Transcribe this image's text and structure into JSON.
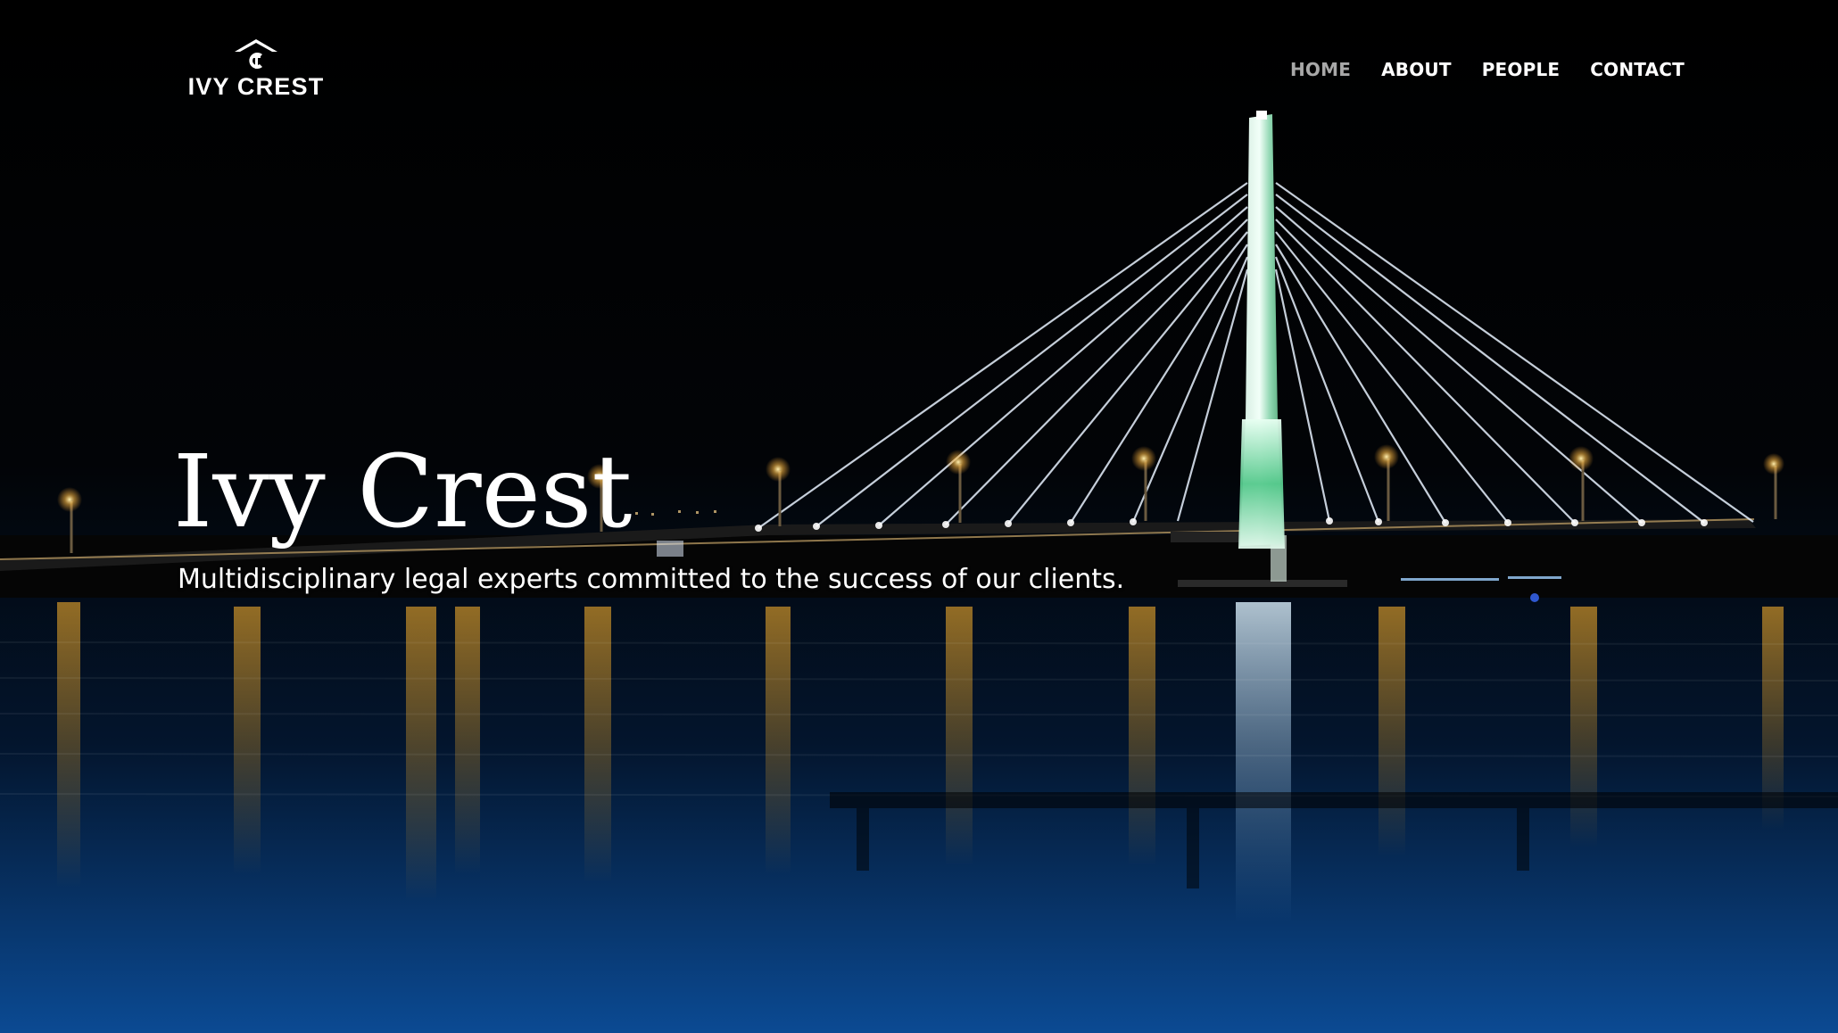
{
  "brand": {
    "name": "IVY CREST"
  },
  "nav": {
    "items": [
      {
        "label": "HOME",
        "active": true
      },
      {
        "label": "ABOUT",
        "active": false
      },
      {
        "label": "PEOPLE",
        "active": false
      },
      {
        "label": "CONTACT",
        "active": false
      }
    ]
  },
  "hero": {
    "title": "Ivy Crest",
    "subtitle": "Multidisciplinary legal experts committed to the success of our clients."
  },
  "colors": {
    "active_nav": "#a8a8a8",
    "nav_text": "#ffffff",
    "bottom_gradient": "#0b4a93"
  },
  "icons": {
    "logo_mark": "house-crest-icon"
  }
}
